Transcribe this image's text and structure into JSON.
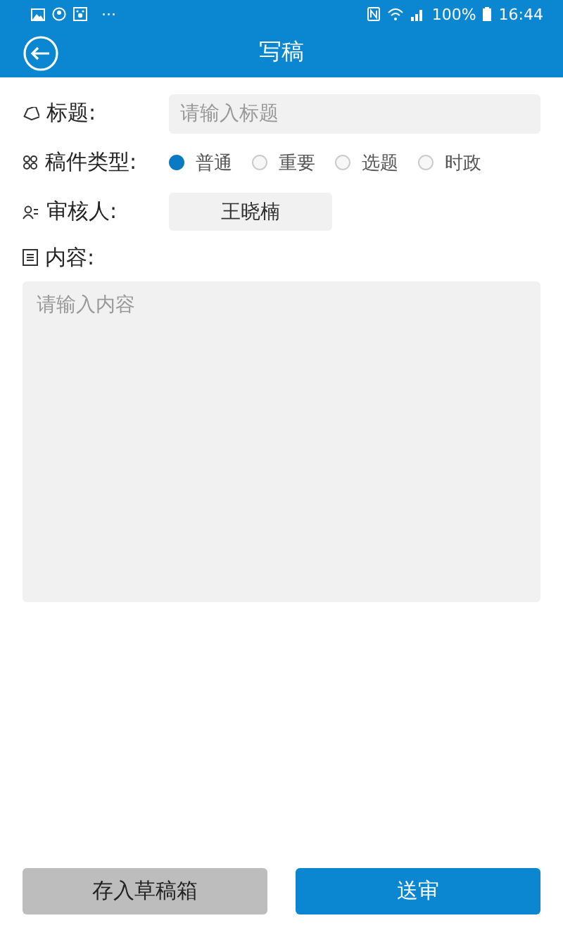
{
  "status_bar": {
    "battery": "100%",
    "time": "16:44",
    "dots": "···"
  },
  "header": {
    "title": "写稿"
  },
  "form": {
    "title_label": "标题:",
    "title_placeholder": "请输入标题",
    "type_label": "稿件类型:",
    "types": [
      {
        "label": "普通",
        "selected": true
      },
      {
        "label": "重要",
        "selected": false
      },
      {
        "label": "选题",
        "selected": false
      },
      {
        "label": "时政",
        "selected": false
      }
    ],
    "reviewer_label": "审核人:",
    "reviewer": "王晓楠",
    "content_label": "内容:",
    "content_placeholder": "请输入内容"
  },
  "buttons": [
    {
      "label": "存入草稿箱",
      "kind": "secondary"
    },
    {
      "label": "送审",
      "kind": "primary"
    }
  ]
}
